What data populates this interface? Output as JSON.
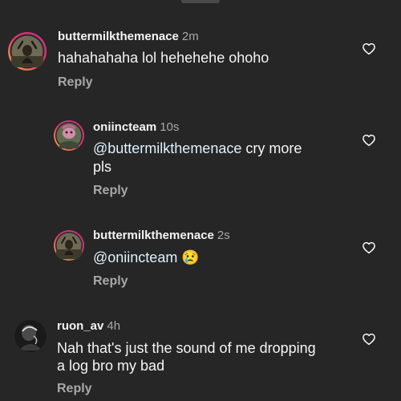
{
  "comments": [
    {
      "username": "buttermilkthemenace",
      "time": "2m",
      "text": "hahahahaha lol hehehehe ohoho",
      "reply_label": "Reply"
    },
    {
      "username": "oniincteam",
      "time": "10s",
      "mention": "@buttermilkthemenace",
      "text_line1_rest": " cry more",
      "text_line2": "pls",
      "reply_label": "Reply"
    },
    {
      "username": "buttermilkthemenace",
      "time": "2s",
      "mention": "@oniincteam",
      "emoji": "😢",
      "reply_label": "Reply"
    },
    {
      "username": "ruon_av",
      "time": "4h",
      "text_line1": "Nah that's just the sound of me dropping",
      "text_line2": "a log bro my bad",
      "reply_label": "Reply"
    }
  ],
  "colors": {
    "background": "#262626",
    "primary_text": "#f5f5f5",
    "secondary_text": "#a8a8a8",
    "mention": "#e0f1ff"
  }
}
